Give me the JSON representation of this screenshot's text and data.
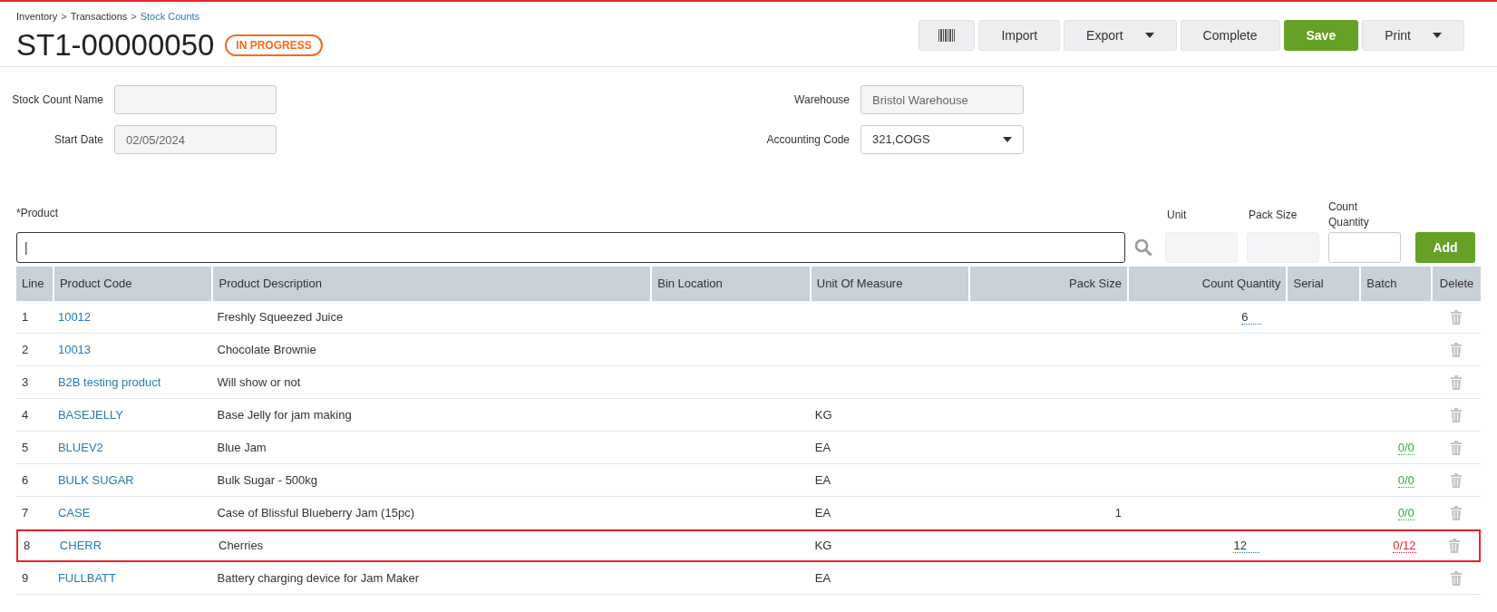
{
  "breadcrumb": [
    {
      "label": "Inventory",
      "link": false
    },
    {
      "label": "Transactions",
      "link": false
    },
    {
      "label": "Stock Counts",
      "link": true
    }
  ],
  "breadcrumb_separator": ">",
  "title": "ST1-00000050",
  "status_badge": "IN PROGRESS",
  "toolbar": [
    {
      "kind": "barcode",
      "primary": false,
      "dropdown": false
    },
    {
      "kind": "text",
      "label": "Import",
      "primary": false,
      "dropdown": false
    },
    {
      "kind": "text",
      "label": "Export",
      "primary": false,
      "dropdown": true
    },
    {
      "kind": "text",
      "label": "Complete",
      "primary": false,
      "dropdown": false
    },
    {
      "kind": "text",
      "label": "Save",
      "primary": true,
      "dropdown": false
    },
    {
      "kind": "text",
      "label": "Print",
      "primary": false,
      "dropdown": true
    }
  ],
  "form_left": [
    {
      "label": "Stock Count Name",
      "kind": "readonly"
    },
    {
      "label": "Start Date",
      "value": "02/05/2024",
      "kind": "readonly"
    }
  ],
  "form_right": [
    {
      "label": "Warehouse",
      "value": "Bristol Warehouse",
      "kind": "readonly"
    },
    {
      "label": "Accounting Code",
      "value": "321,COGS",
      "kind": "select"
    }
  ],
  "product_entry": {
    "label": "*Product",
    "value": "|",
    "unit_label": "Unit",
    "pack_size_label": "Pack Size",
    "count_quantity_label": "Count Quantity",
    "add_button": "Add"
  },
  "table": {
    "columns": [
      "Line",
      "Product Code",
      "Product Description",
      "Bin Location",
      "Unit Of Measure",
      "Pack Size",
      "Count Quantity",
      "Serial",
      "Batch",
      "Delete"
    ],
    "rows": [
      {
        "line": "1",
        "code": "10012",
        "description": "Freshly Squeezed Juice",
        "bin": "",
        "uom": "",
        "pack_size": "",
        "count": "6",
        "serial": "",
        "highlighted": false
      },
      {
        "line": "2",
        "code": "10013",
        "description": "Chocolate Brownie",
        "bin": "",
        "uom": "",
        "pack_size": "",
        "count": "",
        "serial": "",
        "highlighted": false
      },
      {
        "line": "3",
        "code": "B2B testing product",
        "description": "Will show or not",
        "bin": "",
        "uom": "",
        "pack_size": "",
        "count": "",
        "serial": "",
        "highlighted": false
      },
      {
        "line": "4",
        "code": "BASEJELLY",
        "description": "Base Jelly for jam making",
        "bin": "",
        "uom": "KG",
        "pack_size": "",
        "count": "",
        "serial": "",
        "highlighted": false
      },
      {
        "line": "5",
        "code": "BLUEV2",
        "description": "Blue Jam",
        "bin": "",
        "uom": "EA",
        "pack_size": "",
        "count": "",
        "serial": "",
        "batch": {
          "text": "0/0",
          "color": "#3aa54a"
        },
        "highlighted": false
      },
      {
        "line": "6",
        "code": "BULK SUGAR",
        "description": "Bulk Sugar - 500kg",
        "bin": "",
        "uom": "EA",
        "pack_size": "",
        "count": "",
        "serial": "",
        "batch": {
          "text": "0/0",
          "color": "#3aa54a"
        },
        "highlighted": false
      },
      {
        "line": "7",
        "code": "CASE",
        "description": "Case of Blissful Blueberry Jam (15pc)",
        "bin": "",
        "uom": "EA",
        "pack_size": "1",
        "count": "",
        "serial": "",
        "batch": {
          "text": "0/0",
          "color": "#3aa54a"
        },
        "highlighted": false
      },
      {
        "line": "8",
        "code": "CHERR",
        "description": "Cherries",
        "bin": "",
        "uom": "KG",
        "pack_size": "",
        "count": "12",
        "serial": "",
        "batch": {
          "text": "0/12",
          "color": "#e5252e"
        },
        "highlighted": true
      },
      {
        "line": "9",
        "code": "FULLBATT",
        "description": "Battery charging device for Jam Maker",
        "bin": "",
        "uom": "EA",
        "pack_size": "",
        "count": "",
        "serial": "",
        "highlighted": false
      }
    ]
  }
}
